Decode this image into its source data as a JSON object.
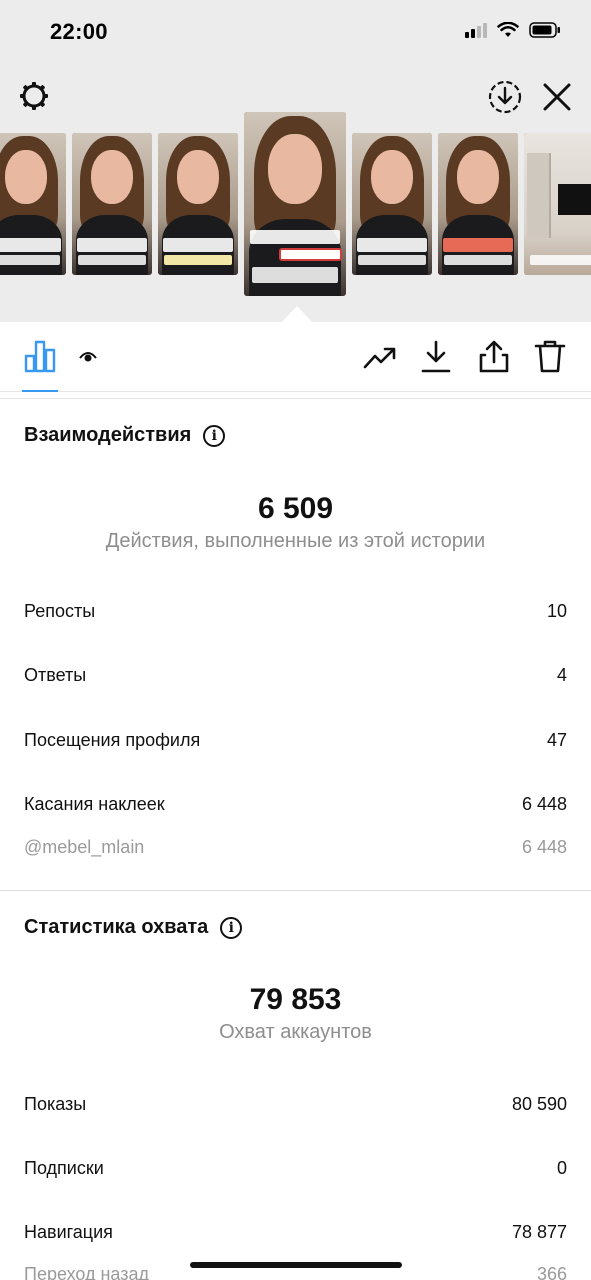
{
  "status_bar": {
    "time": "22:00"
  },
  "interactions": {
    "title": "Взаимодействия",
    "total": "6 509",
    "subtitle": "Действия, выполненные из этой истории",
    "rows": [
      {
        "label": "Репосты",
        "value": "10"
      },
      {
        "label": "Ответы",
        "value": "4"
      },
      {
        "label": "Посещения профиля",
        "value": "47"
      },
      {
        "label": "Касания наклеек",
        "value": "6 448"
      }
    ],
    "sub_row": {
      "label": "@mebel_mlain",
      "value": "6 448"
    }
  },
  "reach": {
    "title": "Статистика охвата",
    "total": "79 853",
    "subtitle": "Охват аккаунтов",
    "rows": [
      {
        "label": "Показы",
        "value": "80 590"
      },
      {
        "label": "Подписки",
        "value": "0"
      },
      {
        "label": "Навигация",
        "value": "78 877"
      }
    ],
    "sub_row": {
      "label": "Переход назад",
      "value": "366"
    }
  },
  "icons": {
    "settings": "gear-icon",
    "download_circle": "download-circle-icon",
    "close": "close-icon",
    "stats": "bar-chart-icon",
    "viewers": "eye-icon",
    "promote": "trending-icon",
    "download": "download-icon",
    "share": "share-icon",
    "delete": "trash-icon",
    "info": "info-icon"
  },
  "colors": {
    "accent": "#3897f0",
    "mention_border": "#d23c3c"
  }
}
